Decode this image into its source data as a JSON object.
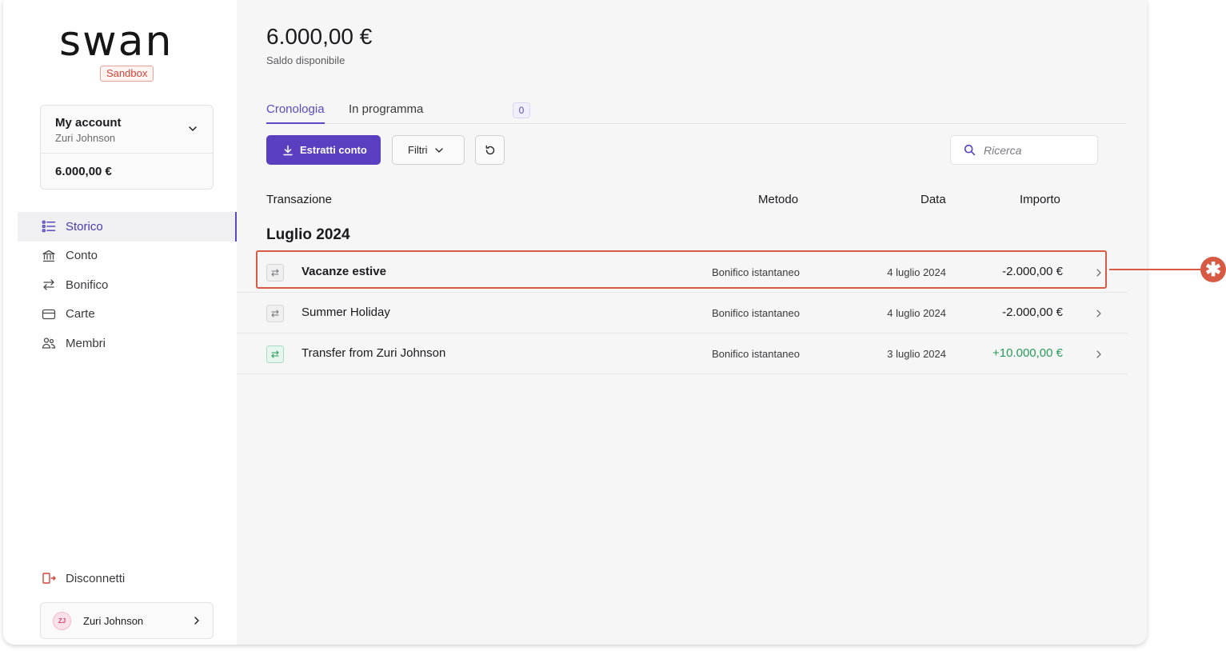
{
  "sidebar": {
    "logo": "swan",
    "env_badge": "Sandbox",
    "account": {
      "name": "My account",
      "holder": "Zuri Johnson",
      "balance": "6.000,00 €"
    },
    "nav": [
      {
        "label": "Storico",
        "icon": "list-icon",
        "active": true
      },
      {
        "label": "Conto",
        "icon": "bank-icon"
      },
      {
        "label": "Bonifico",
        "icon": "transfer-icon"
      },
      {
        "label": "Carte",
        "icon": "card-icon"
      },
      {
        "label": "Membri",
        "icon": "members-icon"
      }
    ],
    "logout": "Disconnetti",
    "user": {
      "initials": "ZJ",
      "name": "Zuri Johnson"
    }
  },
  "main": {
    "balance": "6.000,00 €",
    "balance_label": "Saldo disponibile",
    "tabs": [
      {
        "label": "Cronologia",
        "active": true
      },
      {
        "label": "In programma",
        "badge": "0"
      }
    ],
    "toolbar": {
      "statements_label": "Estratti conto",
      "filters_label": "Filtri",
      "search_placeholder": "Ricerca"
    },
    "columns": {
      "transaction": "Transazione",
      "method": "Metodo",
      "date": "Data",
      "amount": "Importo"
    },
    "group": "Luglio 2024",
    "transactions": [
      {
        "name": "Vacanze estive",
        "method": "Bonifico istantaneo",
        "date": "4 luglio 2024",
        "amount": "-2.000,00 €",
        "direction": "out"
      },
      {
        "name": "Summer Holiday",
        "method": "Bonifico istantaneo",
        "date": "4 luglio 2024",
        "amount": "-2.000,00 €",
        "direction": "out"
      },
      {
        "name": "Transfer from Zuri Johnson",
        "method": "Bonifico istantaneo",
        "date": "3 luglio 2024",
        "amount": "+10.000,00 €",
        "direction": "in"
      }
    ]
  },
  "annotation": {
    "marker": "✱",
    "color": "#d75a45"
  },
  "colors": {
    "accent": "#5b3fc1",
    "positive": "#2a9a5b",
    "highlight": "#d75a45"
  }
}
